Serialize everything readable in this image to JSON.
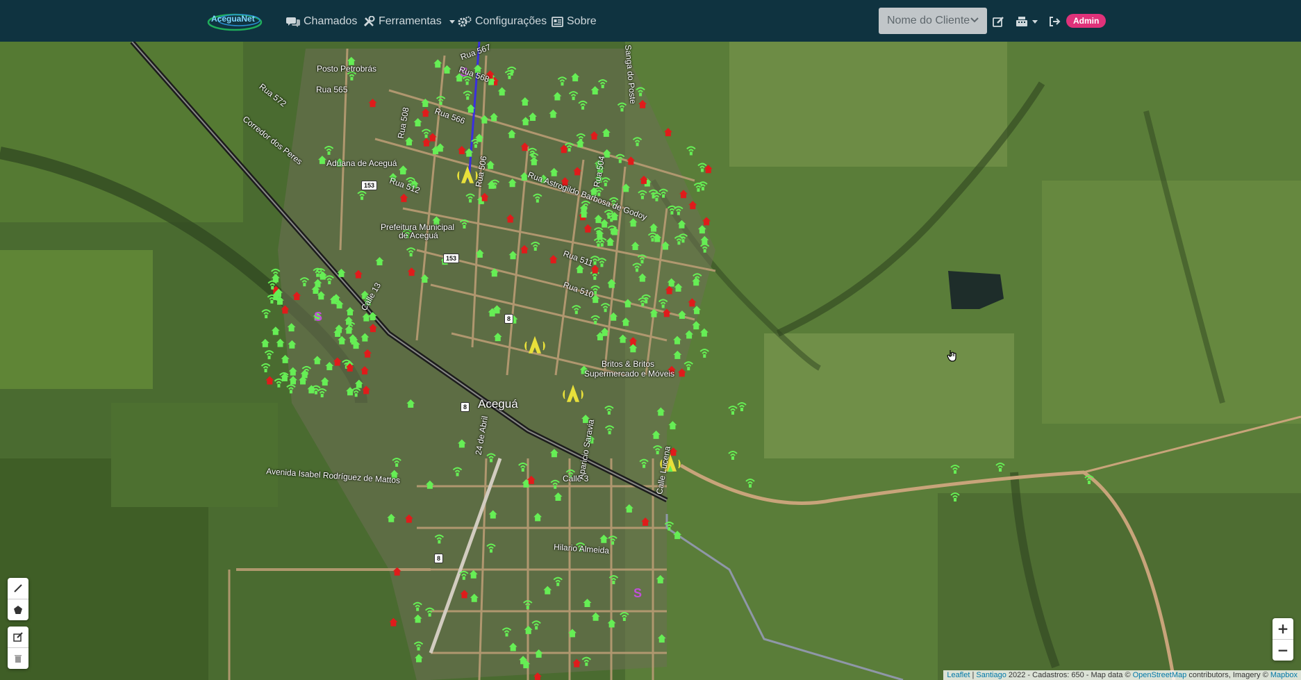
{
  "navbar": {
    "brand": "AceguaNet",
    "links": [
      {
        "label": "Chamados",
        "icon": "comments-icon"
      },
      {
        "label": "Ferramentas",
        "icon": "tools-icon",
        "dropdown": true
      },
      {
        "label": "Configurações",
        "icon": "gears-icon"
      },
      {
        "label": "Sobre",
        "icon": "info-card-icon"
      }
    ],
    "client_select": {
      "value": "Nome do Cliente"
    },
    "actions": [
      {
        "icon": "edit-icon"
      },
      {
        "icon": "cash-register-icon",
        "dropdown": true
      },
      {
        "icon": "logout-icon"
      }
    ],
    "user_badge": "Admin"
  },
  "map": {
    "labels": {
      "posto": "Posto Petrobrás",
      "rua565": "Rua 565",
      "rua572": "Rua 572",
      "corredor": "Corredor dos Peres",
      "rua508": "Rua 508",
      "rua566": "Rua 566",
      "rua568": "Rua 568",
      "rua567": "Rua 567",
      "sanga": "Sanga do Poste",
      "aduana": "Aduana de Aceguá",
      "rua512": "Rua 512",
      "rua506": "Rua 506",
      "rua504": "Rua 504",
      "astrogildo": "Rua Astrogildo Barbosa de Godoy",
      "prefeitura1": "Prefeitura Municipal",
      "prefeitura2": "de Aceguá",
      "rua511": "Rua 511",
      "rua510": "Rua 510",
      "calle13": "Calle 13",
      "britos1": "Britos & Britos",
      "britos2": "Supermercado e Móveis",
      "acegua": "Aceguá",
      "abril": "24 de Abril",
      "calle3": "Calle 3",
      "isabel": "Avenida Isabel Rodríguez de Mattos",
      "hilario": "Hilario Almeida",
      "lucena": "Calle Lucena",
      "aparicio": "Aparicio Saravia"
    },
    "shields": [
      "153",
      "153",
      "8",
      "8",
      "8"
    ],
    "zoom": {
      "in": "+",
      "out": "−"
    },
    "draw_tools": [
      {
        "icon": "polyline-icon"
      },
      {
        "icon": "polygon-icon"
      },
      {
        "icon": "edit-layers-icon"
      },
      {
        "icon": "trash-icon"
      }
    ],
    "attribution": {
      "leaflet": "Leaflet",
      "sep1": " | ",
      "santiago": "Santiago",
      "text": " 2022 - Cadastros: 650 - Map data © ",
      "osm": "OpenStreetMap",
      "text2": " contributors, Imagery © ",
      "mapbox": "Mapbox"
    },
    "colors": {
      "client_active": "#66ee55",
      "client_inactive": "#e01b1b",
      "tower": "#e8e03a",
      "special": "#c04fd8"
    }
  }
}
